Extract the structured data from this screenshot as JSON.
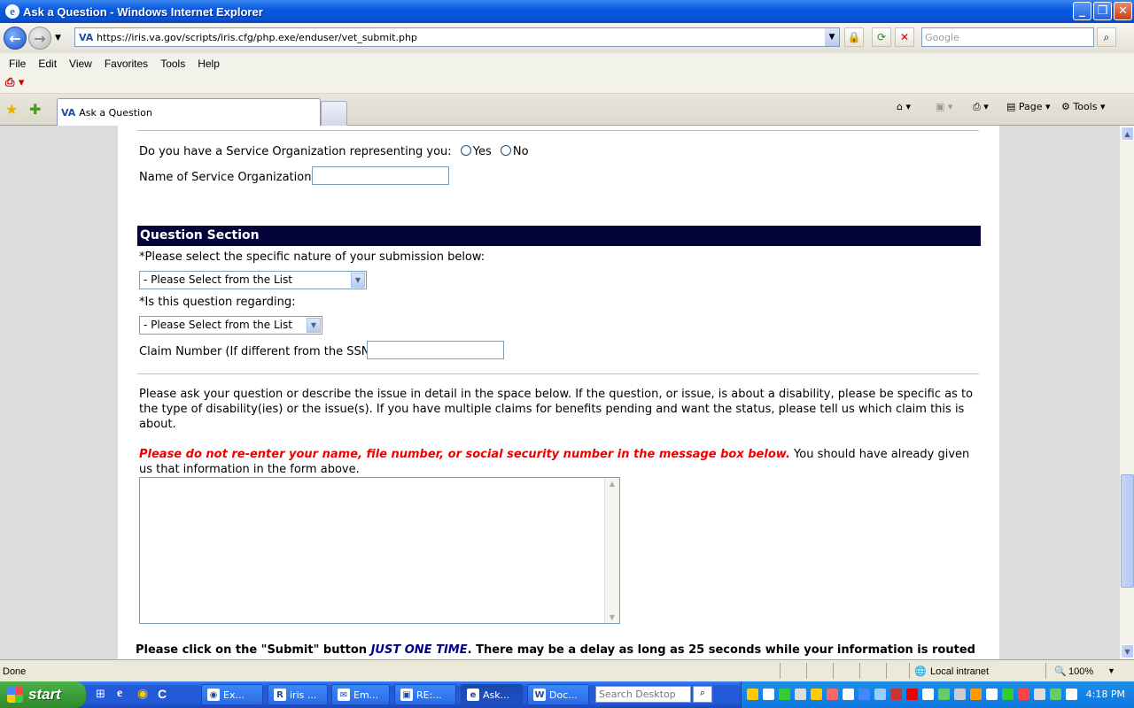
{
  "window": {
    "title": "Ask a Question - Windows Internet Explorer"
  },
  "address": {
    "url": "https://iris.va.gov/scripts/iris.cfg/php.exe/enduser/vet_submit.php",
    "search_placeholder": "Google"
  },
  "menu": [
    "File",
    "Edit",
    "View",
    "Favorites",
    "Tools",
    "Help"
  ],
  "tab": {
    "label": "Ask a Question"
  },
  "commands": {
    "page": "Page",
    "tools": "Tools"
  },
  "form": {
    "service_org_question": "Do you have a Service Organization representing you:",
    "yes": "Yes",
    "no": "No",
    "service_org_name_label": "Name of Service Organization:",
    "section_title": "Question Section",
    "nature_label": "*Please select the specific nature of your submission below:",
    "nature_select": "- Please Select from the List",
    "regarding_label": "*Is this question regarding:",
    "regarding_select": "- Please Select from the List",
    "claim_label": "Claim Number (If different from the SSN)",
    "instructions": "Please ask your question or describe the issue in detail in the space below.   If the question, or issue, is about a disability, please be specific as to the type of disability(ies) or the issue(s).    If you have multiple claims for benefits pending and want the status, please tell us which claim this is about.",
    "warning": "Please do not re-enter your name, file number, or social security number in the message box below.",
    "warning_tail": "   You should have already given us that information in the form above.",
    "submit_note_a": "Please click on the \"Submit\" button ",
    "submit_note_b": "JUST ONE TIME",
    "submit_note_c": ".  There may be a delay as long as 25 seconds while your information is routed"
  },
  "status": {
    "text": "Done",
    "zone": "Local intranet",
    "zoom": "100%"
  },
  "taskbar": {
    "start": "start",
    "buttons": [
      "Ex...",
      "iris ...",
      "Em...",
      "RE:...",
      "Ask...",
      "Doc..."
    ],
    "search_placeholder": "Search Desktop",
    "clock": "4:18 PM"
  }
}
